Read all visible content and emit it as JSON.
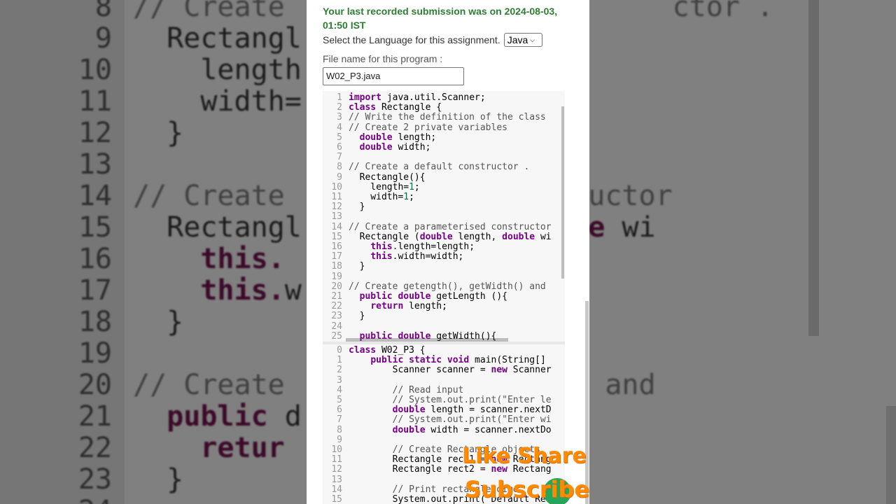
{
  "background": {
    "lines": [
      {
        "n": "8",
        "code": [
          [
            "c",
            "// Create"
          ],
          [
            "p",
            "                       "
          ],
          [
            "c",
            "ctor ."
          ]
        ]
      },
      {
        "n": "9",
        "code": [
          [
            "p",
            "  Rectangl"
          ]
        ]
      },
      {
        "n": "10",
        "code": [
          [
            "p",
            "    length"
          ]
        ]
      },
      {
        "n": "11",
        "code": [
          [
            "p",
            "    width="
          ]
        ]
      },
      {
        "n": "12",
        "code": [
          [
            "p",
            "  }"
          ]
        ]
      },
      {
        "n": "13",
        "code": [
          [
            "p",
            ""
          ]
        ]
      },
      {
        "n": "14",
        "code": [
          [
            "c",
            "// Create"
          ],
          [
            "p",
            "          "
          ],
          [
            "c",
            "d constructor"
          ]
        ]
      },
      {
        "n": "15",
        "code": [
          [
            "p",
            "  Rectangl"
          ],
          [
            "p",
            "        th, "
          ],
          [
            "k",
            "double"
          ],
          [
            "p",
            " wi"
          ]
        ]
      },
      {
        "n": "16",
        "code": [
          [
            "k",
            "    this."
          ]
        ]
      },
      {
        "n": "17",
        "code": [
          [
            "k",
            "    this."
          ],
          [
            "p",
            "w"
          ]
        ]
      },
      {
        "n": "18",
        "code": [
          [
            "p",
            "  }"
          ]
        ]
      },
      {
        "n": "19",
        "code": [
          [
            "p",
            ""
          ]
        ]
      },
      {
        "n": "20",
        "code": [
          [
            "c",
            "// Create"
          ],
          [
            "p",
            "          "
          ],
          [
            "c",
            "tWidth() and"
          ]
        ]
      },
      {
        "n": "21",
        "code": [
          [
            "k",
            "  public"
          ],
          [
            "p",
            " d"
          ],
          [
            "p",
            "         n (){"
          ]
        ]
      },
      {
        "n": "22",
        "code": [
          [
            "k",
            "    retur"
          ]
        ]
      },
      {
        "n": "23",
        "code": [
          [
            "p",
            "  }"
          ]
        ]
      },
      {
        "n": "24",
        "code": [
          [
            "p",
            ""
          ]
        ]
      }
    ]
  },
  "submission_notice": "Your last recorded submission was on 2024-08-03, 01:50 IST",
  "language_label": "Select the Language for this assignment.",
  "language_value": "Java",
  "file_label": "File name for this program :",
  "file_value": "W02_P3.java",
  "editor_top": [
    {
      "n": "1",
      "t": [
        [
          "kw",
          "import"
        ],
        [
          "",
          " java.util.Scanner;"
        ]
      ]
    },
    {
      "n": "2",
      "t": [
        [
          "kw",
          "class"
        ],
        [
          "",
          " Rectangle {"
        ]
      ]
    },
    {
      "n": "3",
      "t": [
        [
          "cm",
          "// Write the definition of the class"
        ]
      ]
    },
    {
      "n": "4",
      "t": [
        [
          "cm",
          "// Create 2 private variables"
        ]
      ]
    },
    {
      "n": "5",
      "t": [
        [
          "",
          "  "
        ],
        [
          "kw",
          "double"
        ],
        [
          "",
          " length;"
        ]
      ]
    },
    {
      "n": "6",
      "t": [
        [
          "",
          "  "
        ],
        [
          "kw",
          "double"
        ],
        [
          "",
          " width;"
        ]
      ]
    },
    {
      "n": "7",
      "t": [
        [
          "",
          ""
        ]
      ]
    },
    {
      "n": "8",
      "t": [
        [
          "cm",
          "// Create a default constructor ."
        ]
      ]
    },
    {
      "n": "9",
      "t": [
        [
          "",
          "  Rectangle(){"
        ]
      ]
    },
    {
      "n": "10",
      "t": [
        [
          "",
          "    length="
        ],
        [
          "nm",
          "1"
        ],
        [
          "",
          ";"
        ]
      ]
    },
    {
      "n": "11",
      "t": [
        [
          "",
          "    width="
        ],
        [
          "nm",
          "1"
        ],
        [
          "",
          ";"
        ]
      ]
    },
    {
      "n": "12",
      "t": [
        [
          "",
          "  }"
        ]
      ]
    },
    {
      "n": "13",
      "t": [
        [
          "",
          ""
        ]
      ]
    },
    {
      "n": "14",
      "t": [
        [
          "cm",
          "// Create a parameterised constructor"
        ]
      ]
    },
    {
      "n": "15",
      "t": [
        [
          "",
          "  Rectangle ("
        ],
        [
          "kw",
          "double"
        ],
        [
          "",
          " length, "
        ],
        [
          "kw",
          "double"
        ],
        [
          "",
          " wi"
        ]
      ]
    },
    {
      "n": "16",
      "t": [
        [
          "",
          "    "
        ],
        [
          "kw",
          "this"
        ],
        [
          "",
          ".length=length;"
        ]
      ]
    },
    {
      "n": "17",
      "t": [
        [
          "",
          "    "
        ],
        [
          "kw",
          "this"
        ],
        [
          "",
          ".width=width;"
        ]
      ]
    },
    {
      "n": "18",
      "t": [
        [
          "",
          "  }"
        ]
      ]
    },
    {
      "n": "19",
      "t": [
        [
          "",
          ""
        ]
      ]
    },
    {
      "n": "20",
      "t": [
        [
          "cm",
          "// Create getength(), getWidth() and"
        ]
      ]
    },
    {
      "n": "21",
      "t": [
        [
          "",
          "  "
        ],
        [
          "kw",
          "public"
        ],
        [
          "",
          " "
        ],
        [
          "kw",
          "double"
        ],
        [
          "",
          " getLength (){"
        ]
      ]
    },
    {
      "n": "22",
      "t": [
        [
          "",
          "    "
        ],
        [
          "kw",
          "return"
        ],
        [
          "",
          " length;"
        ]
      ]
    },
    {
      "n": "23",
      "t": [
        [
          "",
          "  }"
        ]
      ]
    },
    {
      "n": "24",
      "t": [
        [
          "",
          ""
        ]
      ]
    },
    {
      "n": "25",
      "t": [
        [
          "",
          "  "
        ],
        [
          "kw",
          "public"
        ],
        [
          "",
          " "
        ],
        [
          "kw",
          "double"
        ],
        [
          "",
          " getWidth(){"
        ]
      ]
    }
  ],
  "editor_bottom": [
    {
      "n": "0",
      "t": [
        [
          "kw",
          "class"
        ],
        [
          "",
          " W02_P3 {"
        ]
      ]
    },
    {
      "n": "1",
      "t": [
        [
          "",
          "    "
        ],
        [
          "kw",
          "public"
        ],
        [
          "",
          " "
        ],
        [
          "kw",
          "static"
        ],
        [
          "",
          " "
        ],
        [
          "kw",
          "void"
        ],
        [
          "",
          " main(String[]"
        ]
      ]
    },
    {
      "n": "2",
      "t": [
        [
          "",
          "        Scanner scanner = "
        ],
        [
          "kw",
          "new"
        ],
        [
          "",
          " Scanner"
        ]
      ]
    },
    {
      "n": "3",
      "t": [
        [
          "",
          ""
        ]
      ]
    },
    {
      "n": "4",
      "t": [
        [
          "cm",
          "        // Read input"
        ]
      ]
    },
    {
      "n": "5",
      "t": [
        [
          "cm",
          "        // System.out.print(\"Enter le"
        ]
      ]
    },
    {
      "n": "6",
      "t": [
        [
          "",
          "        "
        ],
        [
          "kw",
          "double"
        ],
        [
          "",
          " length = scanner.nextD"
        ]
      ]
    },
    {
      "n": "7",
      "t": [
        [
          "cm",
          "        // System.out.print(\"Enter wi"
        ]
      ]
    },
    {
      "n": "8",
      "t": [
        [
          "",
          "        "
        ],
        [
          "kw",
          "double"
        ],
        [
          "",
          " width = scanner.nextDo"
        ]
      ]
    },
    {
      "n": "9",
      "t": [
        [
          "",
          ""
        ]
      ]
    },
    {
      "n": "10",
      "t": [
        [
          "cm",
          "        // Create Rectangle objects"
        ]
      ]
    },
    {
      "n": "11",
      "t": [
        [
          "",
          "        Rectangle rect1 = "
        ],
        [
          "kw",
          "new"
        ],
        [
          "",
          " Rectang"
        ]
      ]
    },
    {
      "n": "12",
      "t": [
        [
          "",
          "        Rectangle rect2 = "
        ],
        [
          "kw",
          "new"
        ],
        [
          "",
          " Rectang"
        ]
      ]
    },
    {
      "n": "13",
      "t": [
        [
          "",
          ""
        ]
      ]
    },
    {
      "n": "14",
      "t": [
        [
          "cm",
          "        // Print rectangle dime"
        ]
      ]
    },
    {
      "n": "15",
      "t": [
        [
          "",
          "        System.out.print(\"Default Re"
        ]
      ]
    }
  ],
  "promo_like": "Like Share",
  "promo_subscribe": "Subscribe",
  "colors": {
    "submission": "#2e7d32",
    "keyword": "#770088",
    "promo": "#ff8c00"
  }
}
